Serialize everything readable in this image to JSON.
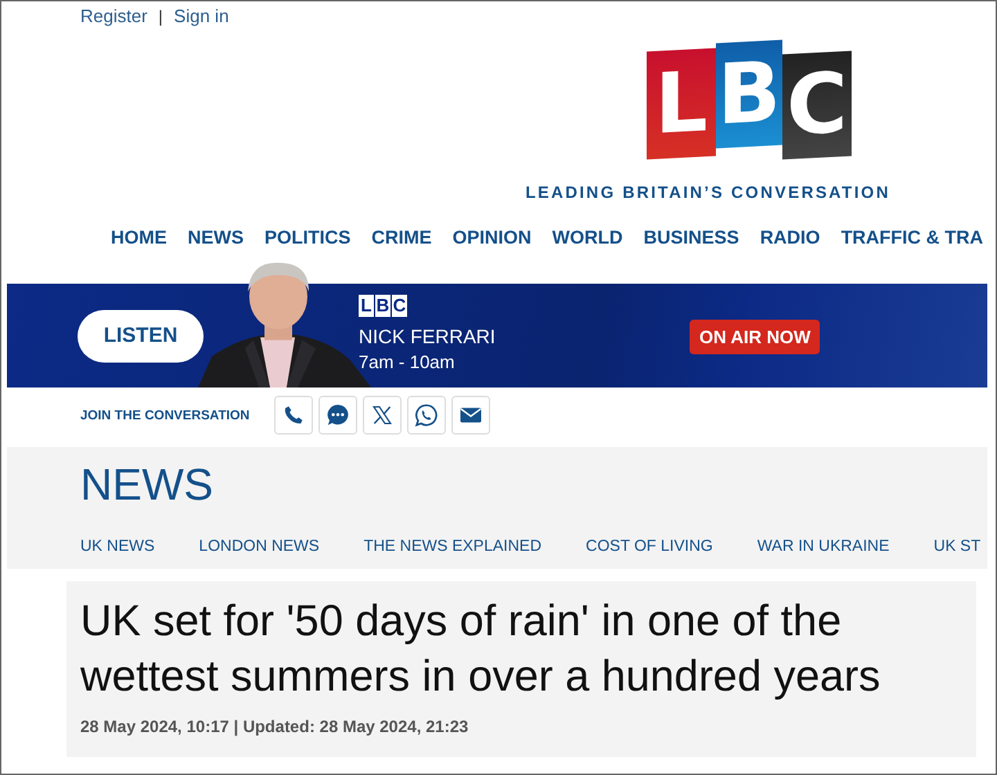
{
  "account_links": [
    "Register",
    "Sign in"
  ],
  "separator": "|",
  "brand": {
    "letters": [
      "L",
      "B",
      "C"
    ],
    "tagline": "LEADING BRITAIN’S CONVERSATION"
  },
  "nav": [
    "HOME",
    "NEWS",
    "POLITICS",
    "CRIME",
    "OPINION",
    "WORLD",
    "BUSINESS",
    "RADIO",
    "TRAFFIC & TRA"
  ],
  "live_banner": {
    "button": "LISTEN",
    "station_letters": [
      "L",
      "B",
      "C"
    ],
    "presenter": "NICK FERRARI",
    "time": "7am - 10am",
    "status": "ON AIR NOW"
  },
  "join": {
    "label": "JOIN THE CONVERSATION",
    "channels": [
      {
        "kind": "phone"
      },
      {
        "kind": "chat"
      },
      {
        "kind": "x"
      },
      {
        "kind": "whatsapp"
      },
      {
        "kind": "email"
      }
    ]
  },
  "section": {
    "title": "NEWS",
    "subnav": [
      "UK NEWS",
      "LONDON NEWS",
      "THE NEWS EXPLAINED",
      "COST OF LIVING",
      "WAR IN UKRAINE",
      "UK ST"
    ]
  },
  "article": {
    "headline": "UK set for '50 days of rain' in one of the wettest summers in over a hundred years",
    "meta": "28 May 2024, 10:17 | Updated: 28 May 2024, 21:23"
  }
}
